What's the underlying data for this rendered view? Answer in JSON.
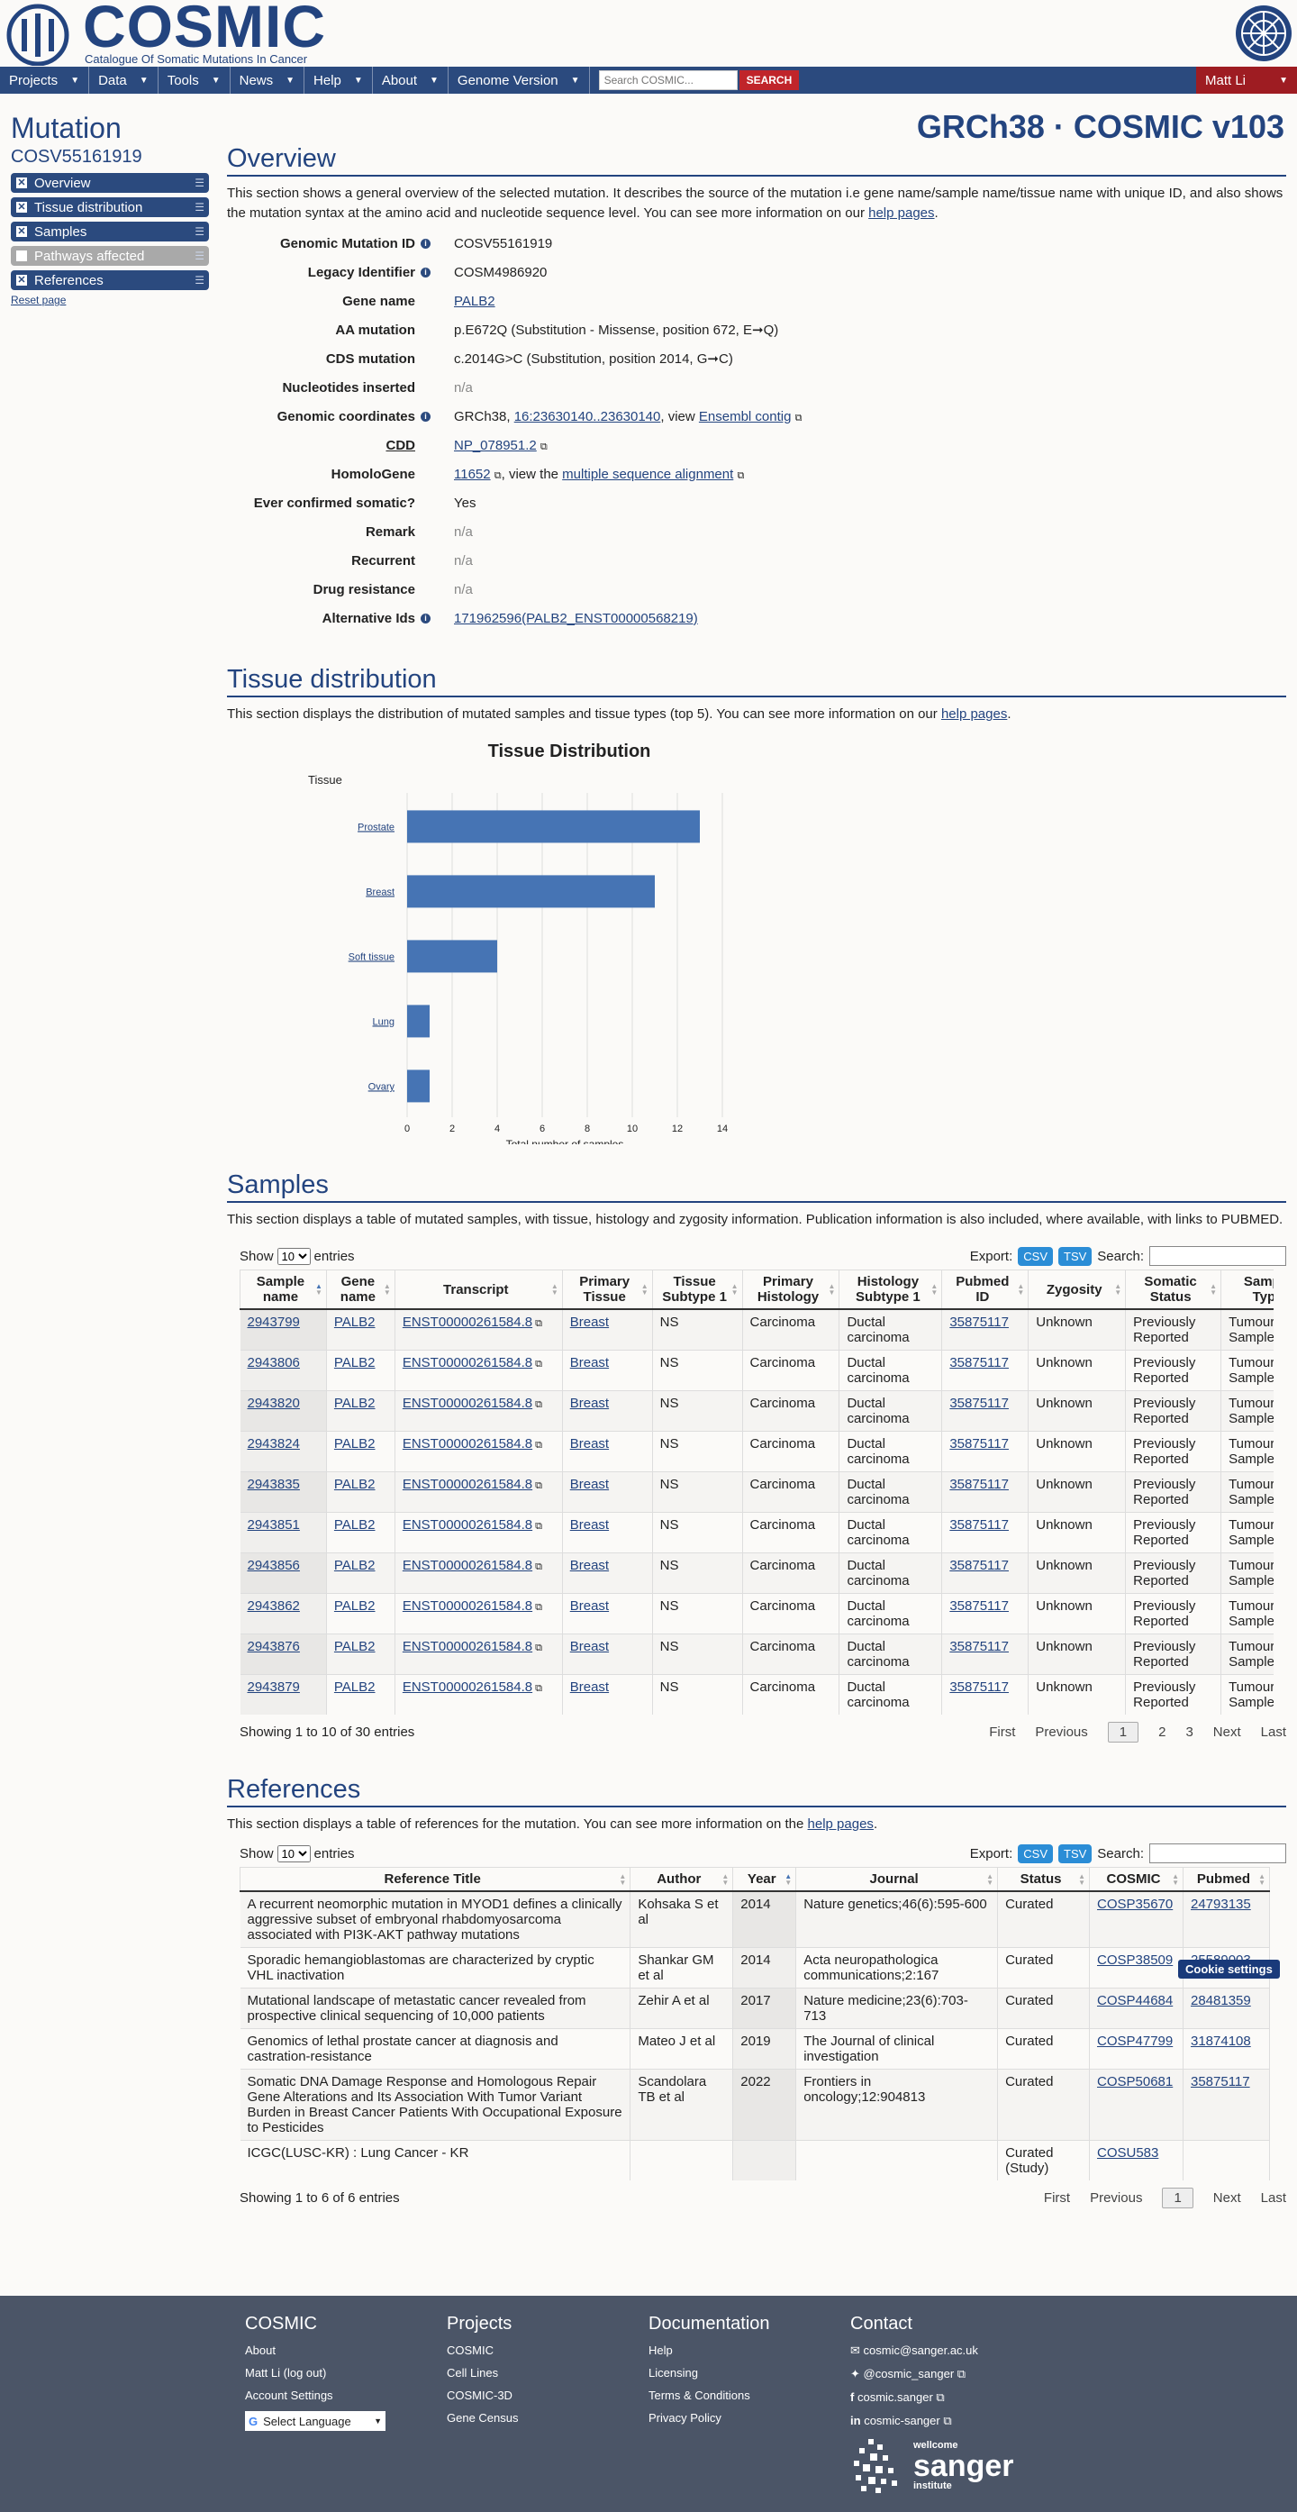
{
  "header": {
    "logo_text": "COSMIC",
    "logo_tagline": "Catalogue Of Somatic Mutations In Cancer"
  },
  "nav": {
    "items": [
      "Projects",
      "Data",
      "Tools",
      "News",
      "Help",
      "About",
      "Genome Version"
    ],
    "search_placeholder": "Search COSMIC...",
    "search_button": "SEARCH",
    "user": "Matt Li"
  },
  "sidebar": {
    "title": "Mutation",
    "id": "COSV55161919",
    "items": [
      {
        "label": "Overview",
        "checked": true
      },
      {
        "label": "Tissue distribution",
        "checked": true
      },
      {
        "label": "Samples",
        "checked": true
      },
      {
        "label": "Pathways affected",
        "checked": false
      },
      {
        "label": "References",
        "checked": true
      }
    ],
    "reset": "Reset page"
  },
  "version": "GRCh38 · COSMIC v103",
  "overview": {
    "title": "Overview",
    "desc_a": "This section shows a general overview of the selected mutation. It describes the source of the mutation i.e gene name/sample name/tissue name with unique ID, and also shows the mutation syntax at the amino acid and nucleotide sequence level. You can see more information on our ",
    "help": "help pages",
    "desc_b": ".",
    "fields": {
      "gmid_k": "Genomic Mutation ID",
      "gmid_v": "COSV55161919",
      "legacy_k": "Legacy Identifier",
      "legacy_v": "COSM4986920",
      "gene_k": "Gene name",
      "gene_v": "PALB2",
      "aa_k": "AA mutation",
      "aa_v": "p.E672Q (Substitution - Missense, position 672, E➞Q)",
      "cds_k": "CDS mutation",
      "cds_v": "c.2014G>C (Substitution, position 2014, G➞C)",
      "nuc_k": "Nucleotides inserted",
      "nuc_v": "n/a",
      "coord_k": "Genomic coordinates",
      "coord_a": "GRCh38, ",
      "coord_link": "16:23630140..23630140",
      "coord_b": ", view ",
      "coord_ens": "Ensembl contig",
      "cdd_k": "CDD",
      "cdd_v": "NP_078951.2",
      "homolo_k": "HomoloGene",
      "homolo_v": "11652",
      "homolo_b": ", view the ",
      "homolo_link": "multiple sequence alignment",
      "ever_k": "Ever confirmed somatic?",
      "ever_v": "Yes",
      "remark_k": "Remark",
      "remark_v": "n/a",
      "recur_k": "Recurrent",
      "recur_v": "n/a",
      "drug_k": "Drug resistance",
      "drug_v": "n/a",
      "alt_k": "Alternative Ids",
      "alt_v": "171962596(PALB2_ENST00000568219)"
    }
  },
  "tissue": {
    "title": "Tissue distribution",
    "desc_a": "This section displays the distribution of mutated samples and tissue types (top 5). You can see more information on our ",
    "help": "help pages",
    "desc_b": "."
  },
  "chart_data": {
    "type": "bar",
    "orientation": "horizontal",
    "title": "Tissue Distribution",
    "categories": [
      "Prostate",
      "Breast",
      "Soft tissue",
      "Lung",
      "Ovary"
    ],
    "series": [
      {
        "name": "Samples with mutation",
        "values": [
          13,
          11,
          4,
          1,
          1
        ]
      }
    ],
    "xlabel": "Total number of samples",
    "ylabel": "Tissue",
    "xlim": [
      0,
      14
    ],
    "xticks": [
      "0",
      "2",
      "4",
      "6",
      "8",
      "10",
      "12",
      "14"
    ],
    "grid": true,
    "legend": "bottom-left",
    "color": "#4674b4"
  },
  "samples": {
    "title": "Samples",
    "desc": "This section displays a table of mutated samples, with tissue, histology and zygosity information. Publication information is also included, where available, with links to PUBMED.",
    "show": "Show",
    "entries": "entries",
    "len": "10",
    "export": "Export:",
    "csv": "CSV",
    "tsv": "TSV",
    "search": "Search:",
    "headers": [
      "Sample name",
      "Gene name",
      "Transcript",
      "Primary Tissue",
      "Tissue Subtype 1",
      "Primary Histology",
      "Histology Subtype 1",
      "Pubmed ID",
      "Zygosity",
      "Somatic Status",
      "Sample Type"
    ],
    "rows": [
      [
        "2943799",
        "PALB2",
        "ENST00000261584.8",
        "Breast",
        "NS",
        "Carcinoma",
        "Ductal carcinoma",
        "35875117",
        "Unknown",
        "Previously Reported",
        "Tumour Sample"
      ],
      [
        "2943806",
        "PALB2",
        "ENST00000261584.8",
        "Breast",
        "NS",
        "Carcinoma",
        "Ductal carcinoma",
        "35875117",
        "Unknown",
        "Previously Reported",
        "Tumour Sample"
      ],
      [
        "2943820",
        "PALB2",
        "ENST00000261584.8",
        "Breast",
        "NS",
        "Carcinoma",
        "Ductal carcinoma",
        "35875117",
        "Unknown",
        "Previously Reported",
        "Tumour Sample"
      ],
      [
        "2943824",
        "PALB2",
        "ENST00000261584.8",
        "Breast",
        "NS",
        "Carcinoma",
        "Ductal carcinoma",
        "35875117",
        "Unknown",
        "Previously Reported",
        "Tumour Sample"
      ],
      [
        "2943835",
        "PALB2",
        "ENST00000261584.8",
        "Breast",
        "NS",
        "Carcinoma",
        "Ductal carcinoma",
        "35875117",
        "Unknown",
        "Previously Reported",
        "Tumour Sample"
      ],
      [
        "2943851",
        "PALB2",
        "ENST00000261584.8",
        "Breast",
        "NS",
        "Carcinoma",
        "Ductal carcinoma",
        "35875117",
        "Unknown",
        "Previously Reported",
        "Tumour Sample"
      ],
      [
        "2943856",
        "PALB2",
        "ENST00000261584.8",
        "Breast",
        "NS",
        "Carcinoma",
        "Ductal carcinoma",
        "35875117",
        "Unknown",
        "Previously Reported",
        "Tumour Sample"
      ],
      [
        "2943862",
        "PALB2",
        "ENST00000261584.8",
        "Breast",
        "NS",
        "Carcinoma",
        "Ductal carcinoma",
        "35875117",
        "Unknown",
        "Previously Reported",
        "Tumour Sample"
      ],
      [
        "2943876",
        "PALB2",
        "ENST00000261584.8",
        "Breast",
        "NS",
        "Carcinoma",
        "Ductal carcinoma",
        "35875117",
        "Unknown",
        "Previously Reported",
        "Tumour Sample"
      ],
      [
        "2943879",
        "PALB2",
        "ENST00000261584.8",
        "Breast",
        "NS",
        "Carcinoma",
        "Ductal carcinoma",
        "35875117",
        "Unknown",
        "Previously Reported",
        "Tumour Sample"
      ]
    ],
    "info": "Showing 1 to 10 of 30 entries",
    "pager": [
      "First",
      "Previous",
      "1",
      "2",
      "3",
      "Next",
      "Last"
    ]
  },
  "references": {
    "title": "References",
    "desc_a": "This section displays a table of references for the mutation. You can see more information on the ",
    "help": "help pages",
    "desc_b": ".",
    "show": "Show",
    "entries": "entries",
    "len": "10",
    "export": "Export:",
    "csv": "CSV",
    "tsv": "TSV",
    "search": "Search:",
    "headers": [
      "Reference Title",
      "Author",
      "Year",
      "Journal",
      "Status",
      "COSMIC",
      "Pubmed"
    ],
    "rows": [
      [
        "A recurrent neomorphic mutation in MYOD1 defines a clinically aggressive subset of embryonal rhabdomyosarcoma associated with PI3K-AKT pathway mutations",
        "Kohsaka S et al",
        "2014",
        "Nature genetics;46(6):595-600",
        "Curated",
        "COSP35670",
        "24793135"
      ],
      [
        "Sporadic hemangioblastomas are characterized by cryptic VHL inactivation",
        "Shankar GM et al",
        "2014",
        "Acta neuropathologica communications;2:167",
        "Curated",
        "COSP38509",
        "25589003"
      ],
      [
        "Mutational landscape of metastatic cancer revealed from prospective clinical sequencing of 10,000 patients",
        "Zehir A et al",
        "2017",
        "Nature medicine;23(6):703-713",
        "Curated",
        "COSP44684",
        "28481359"
      ],
      [
        "Genomics of lethal prostate cancer at diagnosis and castration-resistance",
        "Mateo J et al",
        "2019",
        "The Journal of clinical investigation",
        "Curated",
        "COSP47799",
        "31874108"
      ],
      [
        "Somatic DNA Damage Response and Homologous Repair Gene Alterations and Its Association With Tumor Variant Burden in Breast Cancer Patients With Occupational Exposure to Pesticides",
        "Scandolara TB et al",
        "2022",
        "Frontiers in oncology;12:904813",
        "Curated",
        "COSP50681",
        "35875117"
      ],
      [
        "ICGC(LUSC-KR) : Lung Cancer - KR",
        "",
        "",
        "",
        "Curated (Study)",
        "COSU583",
        ""
      ]
    ],
    "info": "Showing 1 to 6 of 6 entries",
    "pager": [
      "First",
      "Previous",
      "1",
      "Next",
      "Last"
    ],
    "cookie": "Cookie settings"
  },
  "footer": {
    "cols": [
      {
        "title": "COSMIC",
        "links": [
          "About",
          "Matt Li (log out)",
          "Account Settings"
        ]
      },
      {
        "title": "Projects",
        "links": [
          "COSMIC",
          "Cell Lines",
          "COSMIC-3D",
          "Gene Census"
        ]
      },
      {
        "title": "Documentation",
        "links": [
          "Help",
          "Licensing",
          "Terms & Conditions",
          "Privacy Policy"
        ]
      },
      {
        "title": "Contact",
        "links": [
          "cosmic@sanger.ac.uk",
          "@cosmic_sanger",
          "cosmic.sanger",
          "cosmic-sanger"
        ]
      }
    ],
    "language": "Select Language",
    "sanger_small": "wellcome",
    "sanger_big": "sanger",
    "sanger_inst": "institute"
  }
}
